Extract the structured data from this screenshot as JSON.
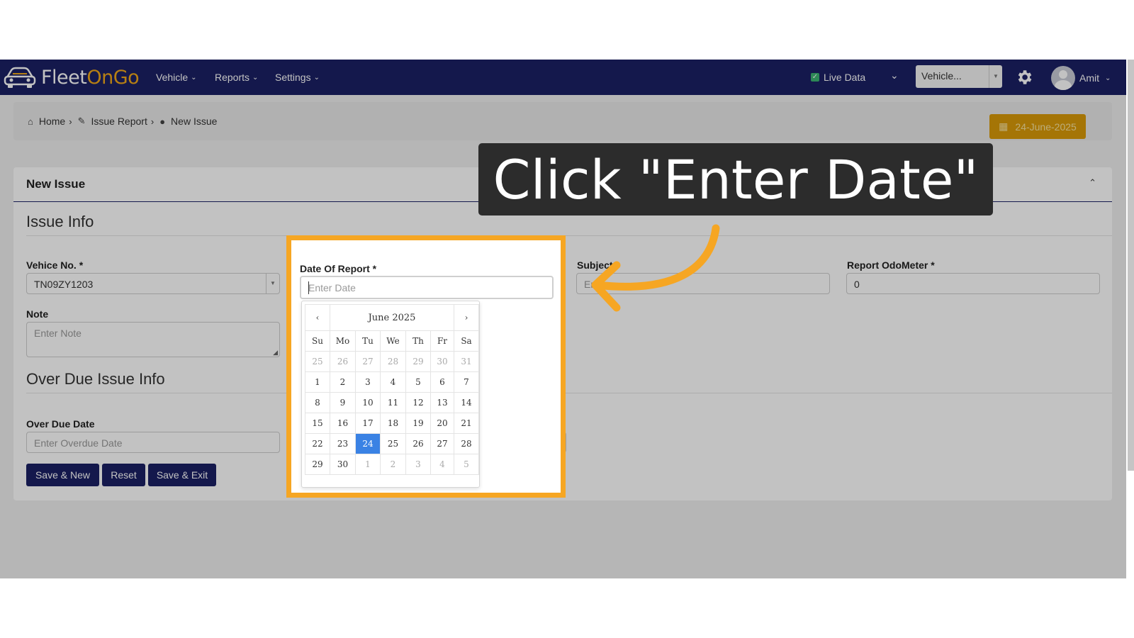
{
  "nav": {
    "brand_part1": "Fleet",
    "brand_part2": "OnGo",
    "menu": [
      "Vehicle",
      "Reports",
      "Settings"
    ],
    "live_data_label": "Live Data",
    "vehicle_select": "Vehicle...",
    "user_name": "Amit"
  },
  "breadcrumb": [
    "Home",
    "Issue Report",
    "New Issue"
  ],
  "date_badge": "24-June-2025",
  "card": {
    "title": "New Issue",
    "section_issue": "Issue Info",
    "section_overdue": "Over Due Issue Info"
  },
  "form": {
    "vehicle_label": "Vehice No. *",
    "vehicle_value": "TN09ZY1203",
    "note_label": "Note",
    "note_placeholder": "Enter Note",
    "date_label": "Date Of Report *",
    "date_placeholder": "Enter Date",
    "subject_label": "Subject *",
    "subject_placeholder": "Ent",
    "odometer_label": "Report OdoMeter *",
    "odometer_value": "0",
    "overdue_label": "Over Due Date",
    "overdue_placeholder": "Enter Overdue Date"
  },
  "buttons": [
    "Save & New",
    "Reset",
    "Save & Exit"
  ],
  "calendar": {
    "month_label": "June 2025",
    "prev": "‹",
    "next": "›",
    "weekdays": [
      "Su",
      "Mo",
      "Tu",
      "We",
      "Th",
      "Fr",
      "Sa"
    ],
    "weeks": [
      [
        "25",
        "26",
        "27",
        "28",
        "29",
        "30",
        "31"
      ],
      [
        "1",
        "2",
        "3",
        "4",
        "5",
        "6",
        "7"
      ],
      [
        "8",
        "9",
        "10",
        "11",
        "12",
        "13",
        "14"
      ],
      [
        "15",
        "16",
        "17",
        "18",
        "19",
        "20",
        "21"
      ],
      [
        "22",
        "23",
        "24",
        "25",
        "26",
        "27",
        "28"
      ],
      [
        "29",
        "30",
        "1",
        "2",
        "3",
        "4",
        "5"
      ]
    ],
    "selected": "24"
  },
  "tooltip": "Click \"Enter Date\"",
  "colors": {
    "navbar": "#1b2064",
    "accent": "#f6a623",
    "date_badge": "#d99a08",
    "selected_day": "#3a82e4"
  }
}
